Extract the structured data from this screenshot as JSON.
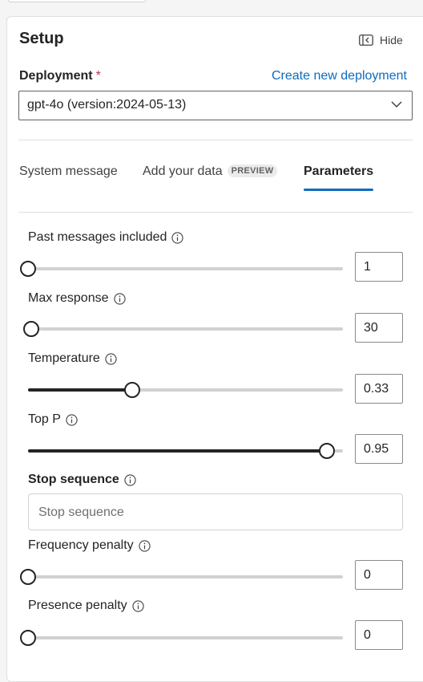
{
  "setup": {
    "title": "Setup",
    "hide_label": "Hide"
  },
  "deployment": {
    "label": "Deployment",
    "required_marker": "*",
    "create_link": "Create new deployment",
    "selected": "gpt-4o (version:2024-05-13)"
  },
  "tabs": [
    {
      "label": "System message",
      "active": false
    },
    {
      "label": "Add your data",
      "badge": "PREVIEW",
      "active": false
    },
    {
      "label": "Parameters",
      "active": true
    }
  ],
  "params": {
    "past_messages": {
      "label": "Past messages included",
      "value": "1",
      "fraction": 0.0
    },
    "max_response": {
      "label": "Max response",
      "value": "30",
      "fraction": 0.01
    },
    "temperature": {
      "label": "Temperature",
      "value": "0.33",
      "fraction": 0.33
    },
    "top_p": {
      "label": "Top P",
      "value": "0.95",
      "fraction": 0.95
    },
    "stop_sequence": {
      "label": "Stop sequence",
      "placeholder": "Stop sequence"
    },
    "frequency_penalty": {
      "label": "Frequency penalty",
      "value": "0",
      "fraction": 0.0
    },
    "presence_penalty": {
      "label": "Presence penalty",
      "value": "0",
      "fraction": 0.0
    }
  },
  "colors": {
    "accent": "#0f6cbd",
    "required": "#c4314b",
    "slider_fill": "#242424",
    "slider_track": "#d1d1d1"
  }
}
